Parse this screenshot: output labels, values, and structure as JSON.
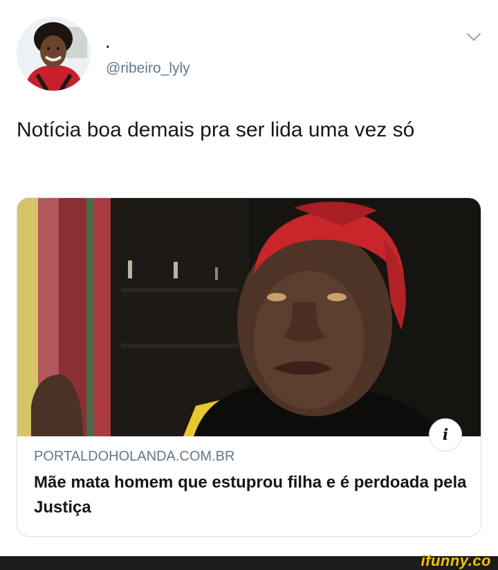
{
  "tweet": {
    "display_name": ".",
    "handle": "@ribeiro_lyly",
    "text": "Notícia boa demais pra ser lida uma vez só"
  },
  "card": {
    "domain": "PORTALDOHOLANDA.COM.BR",
    "title": "Mãe mata homem que estuprou filha e é perdoada pela Justiça",
    "info_icon": "info-icon",
    "info_glyph": "i"
  },
  "icons": {
    "menu": "chevron-down-icon"
  },
  "watermark": {
    "text": "ifunny.co"
  },
  "colors": {
    "secondary_text": "#657786",
    "card_border": "#d8dee3",
    "watermark": "#f2c200",
    "headscarf": "#c8262a"
  }
}
